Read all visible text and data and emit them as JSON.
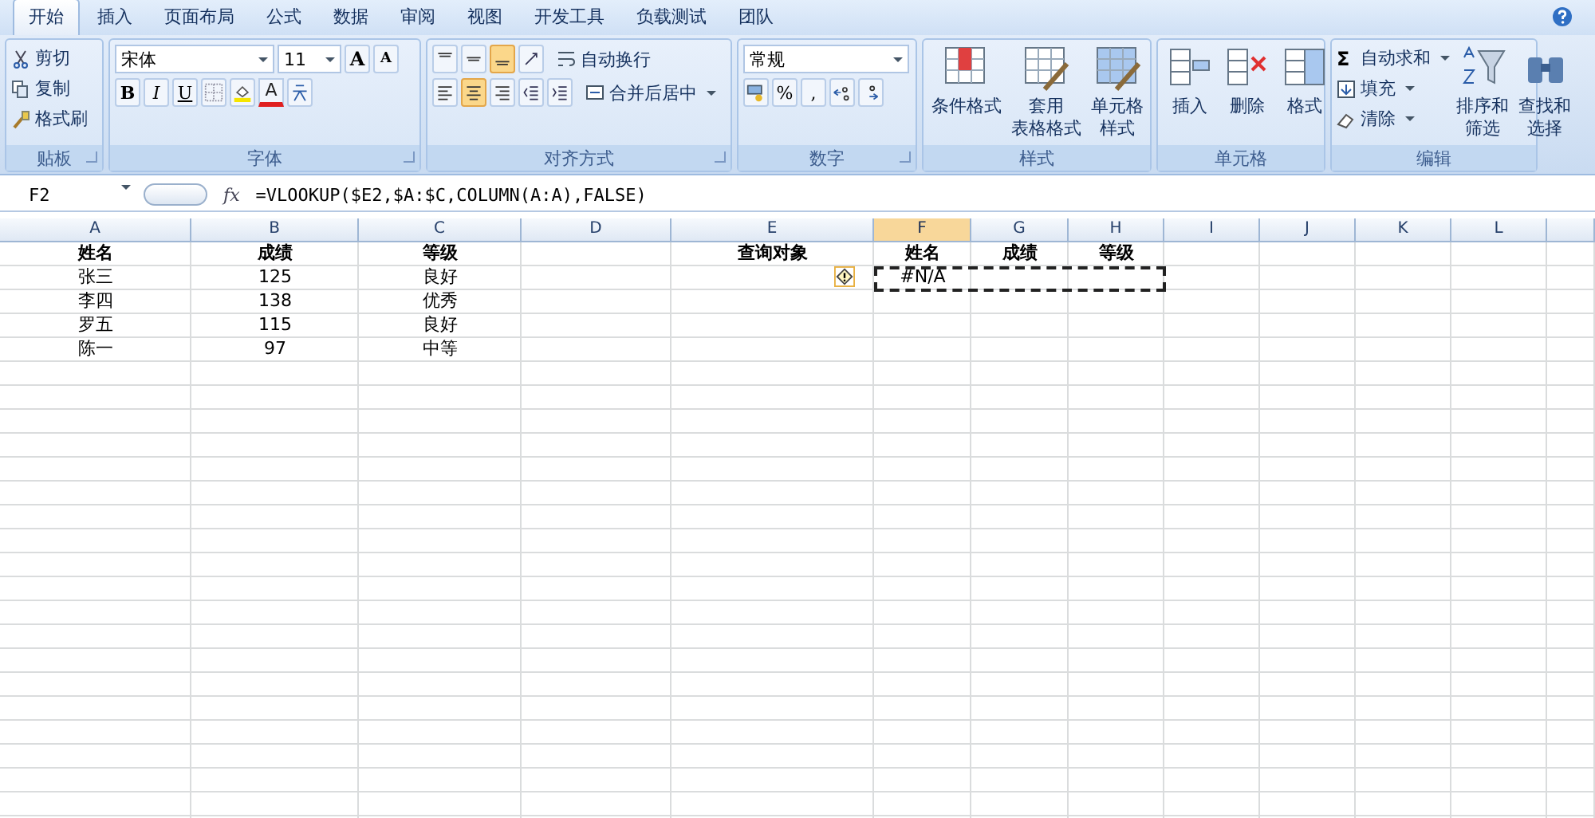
{
  "tabs": [
    {
      "label": "开始",
      "selected": true
    },
    {
      "label": "插入",
      "selected": false
    },
    {
      "label": "页面布局",
      "selected": false
    },
    {
      "label": "公式",
      "selected": false
    },
    {
      "label": "数据",
      "selected": false
    },
    {
      "label": "审阅",
      "selected": false
    },
    {
      "label": "视图",
      "selected": false
    },
    {
      "label": "开发工具",
      "selected": false
    },
    {
      "label": "负载测试",
      "selected": false
    },
    {
      "label": "团队",
      "selected": false
    }
  ],
  "ribbon": {
    "clipboard": {
      "title": "贴板",
      "cut": "剪切",
      "copy": "复制",
      "format_painter": "格式刷"
    },
    "font": {
      "title": "字体",
      "font_name": "宋体",
      "font_size": "11",
      "grow": "A",
      "shrink": "A",
      "bold": "B",
      "italic": "I",
      "underline": "U",
      "font_color": "A"
    },
    "alignment": {
      "title": "对齐方式",
      "wrap": "自动换行",
      "merge": "合并后居中"
    },
    "number": {
      "title": "数字",
      "format": "常规",
      "percent": "%",
      "comma": ","
    },
    "styles": {
      "title": "样式",
      "conditional": [
        "条件格式"
      ],
      "table": [
        "套用",
        "表格格式"
      ],
      "cell": [
        "单元格",
        "样式"
      ]
    },
    "cells": {
      "title": "单元格",
      "insert": "插入",
      "delete": "删除",
      "format": "格式"
    },
    "editing": {
      "title": "编辑",
      "autosum_symbol": "Σ",
      "autosum": "自动求和",
      "fill": "填充",
      "clear": "清除",
      "sort": [
        "排序和",
        "筛选"
      ],
      "find": [
        "查找和",
        "选择"
      ]
    }
  },
  "formula_bar": {
    "name_box": "F2",
    "fx": "fx",
    "formula": "=VLOOKUP($E2,$A:$C,COLUMN(A:A),FALSE)"
  },
  "sheet": {
    "columns": [
      {
        "label": "A",
        "selected": false
      },
      {
        "label": "B",
        "selected": false
      },
      {
        "label": "C",
        "selected": false
      },
      {
        "label": "D",
        "selected": false
      },
      {
        "label": "E",
        "selected": false
      },
      {
        "label": "F",
        "selected": true
      },
      {
        "label": "G",
        "selected": false
      },
      {
        "label": "H",
        "selected": false
      },
      {
        "label": "I",
        "selected": false
      },
      {
        "label": "J",
        "selected": false
      },
      {
        "label": "K",
        "selected": false
      },
      {
        "label": "L",
        "selected": false
      }
    ],
    "rows": [
      {
        "bold": true,
        "cells": [
          {
            "text": "姓名"
          },
          {
            "text": "成绩"
          },
          {
            "text": "等级"
          },
          {},
          {
            "text": "查询对象"
          },
          {
            "text": "姓名"
          },
          {
            "text": "成绩"
          },
          {
            "text": "等级"
          }
        ]
      },
      {
        "bold": false,
        "cells": [
          {
            "text": "张三"
          },
          {
            "text": "125"
          },
          {
            "text": "良好"
          },
          {},
          {
            "error_indicator": true
          },
          {
            "text": "#N/A",
            "marquee": true
          },
          {
            "marquee": true
          },
          {
            "marquee": true
          }
        ]
      },
      {
        "bold": false,
        "cells": [
          {
            "text": "李四"
          },
          {
            "text": "138"
          },
          {
            "text": "优秀"
          }
        ]
      },
      {
        "bold": false,
        "cells": [
          {
            "text": "罗五"
          },
          {
            "text": "115"
          },
          {
            "text": "良好"
          }
        ]
      },
      {
        "bold": false,
        "cells": [
          {
            "text": "陈一"
          },
          {
            "text": "97"
          },
          {
            "text": "中等"
          }
        ]
      }
    ]
  }
}
